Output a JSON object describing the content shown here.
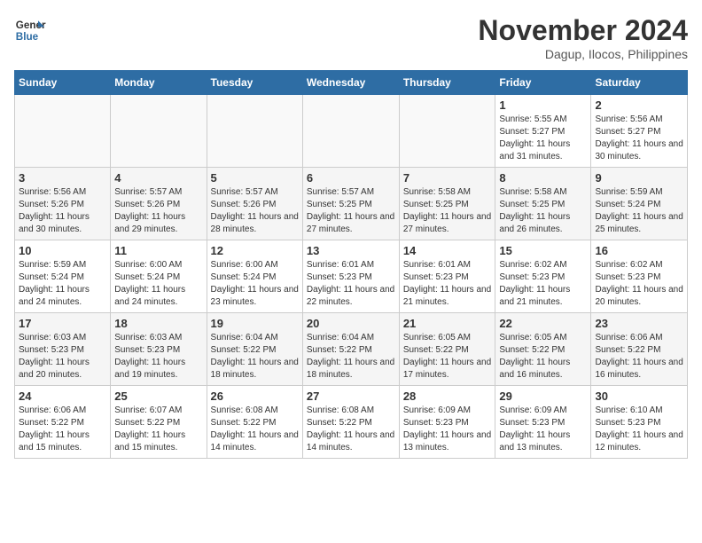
{
  "header": {
    "logo_line1": "General",
    "logo_line2": "Blue",
    "month_title": "November 2024",
    "location": "Dagup, Ilocos, Philippines"
  },
  "weekdays": [
    "Sunday",
    "Monday",
    "Tuesday",
    "Wednesday",
    "Thursday",
    "Friday",
    "Saturday"
  ],
  "weeks": [
    [
      {
        "day": "",
        "info": ""
      },
      {
        "day": "",
        "info": ""
      },
      {
        "day": "",
        "info": ""
      },
      {
        "day": "",
        "info": ""
      },
      {
        "day": "",
        "info": ""
      },
      {
        "day": "1",
        "info": "Sunrise: 5:55 AM\nSunset: 5:27 PM\nDaylight: 11 hours and 31 minutes."
      },
      {
        "day": "2",
        "info": "Sunrise: 5:56 AM\nSunset: 5:27 PM\nDaylight: 11 hours and 30 minutes."
      }
    ],
    [
      {
        "day": "3",
        "info": "Sunrise: 5:56 AM\nSunset: 5:26 PM\nDaylight: 11 hours and 30 minutes."
      },
      {
        "day": "4",
        "info": "Sunrise: 5:57 AM\nSunset: 5:26 PM\nDaylight: 11 hours and 29 minutes."
      },
      {
        "day": "5",
        "info": "Sunrise: 5:57 AM\nSunset: 5:26 PM\nDaylight: 11 hours and 28 minutes."
      },
      {
        "day": "6",
        "info": "Sunrise: 5:57 AM\nSunset: 5:25 PM\nDaylight: 11 hours and 27 minutes."
      },
      {
        "day": "7",
        "info": "Sunrise: 5:58 AM\nSunset: 5:25 PM\nDaylight: 11 hours and 27 minutes."
      },
      {
        "day": "8",
        "info": "Sunrise: 5:58 AM\nSunset: 5:25 PM\nDaylight: 11 hours and 26 minutes."
      },
      {
        "day": "9",
        "info": "Sunrise: 5:59 AM\nSunset: 5:24 PM\nDaylight: 11 hours and 25 minutes."
      }
    ],
    [
      {
        "day": "10",
        "info": "Sunrise: 5:59 AM\nSunset: 5:24 PM\nDaylight: 11 hours and 24 minutes."
      },
      {
        "day": "11",
        "info": "Sunrise: 6:00 AM\nSunset: 5:24 PM\nDaylight: 11 hours and 24 minutes."
      },
      {
        "day": "12",
        "info": "Sunrise: 6:00 AM\nSunset: 5:24 PM\nDaylight: 11 hours and 23 minutes."
      },
      {
        "day": "13",
        "info": "Sunrise: 6:01 AM\nSunset: 5:23 PM\nDaylight: 11 hours and 22 minutes."
      },
      {
        "day": "14",
        "info": "Sunrise: 6:01 AM\nSunset: 5:23 PM\nDaylight: 11 hours and 21 minutes."
      },
      {
        "day": "15",
        "info": "Sunrise: 6:02 AM\nSunset: 5:23 PM\nDaylight: 11 hours and 21 minutes."
      },
      {
        "day": "16",
        "info": "Sunrise: 6:02 AM\nSunset: 5:23 PM\nDaylight: 11 hours and 20 minutes."
      }
    ],
    [
      {
        "day": "17",
        "info": "Sunrise: 6:03 AM\nSunset: 5:23 PM\nDaylight: 11 hours and 20 minutes."
      },
      {
        "day": "18",
        "info": "Sunrise: 6:03 AM\nSunset: 5:23 PM\nDaylight: 11 hours and 19 minutes."
      },
      {
        "day": "19",
        "info": "Sunrise: 6:04 AM\nSunset: 5:22 PM\nDaylight: 11 hours and 18 minutes."
      },
      {
        "day": "20",
        "info": "Sunrise: 6:04 AM\nSunset: 5:22 PM\nDaylight: 11 hours and 18 minutes."
      },
      {
        "day": "21",
        "info": "Sunrise: 6:05 AM\nSunset: 5:22 PM\nDaylight: 11 hours and 17 minutes."
      },
      {
        "day": "22",
        "info": "Sunrise: 6:05 AM\nSunset: 5:22 PM\nDaylight: 11 hours and 16 minutes."
      },
      {
        "day": "23",
        "info": "Sunrise: 6:06 AM\nSunset: 5:22 PM\nDaylight: 11 hours and 16 minutes."
      }
    ],
    [
      {
        "day": "24",
        "info": "Sunrise: 6:06 AM\nSunset: 5:22 PM\nDaylight: 11 hours and 15 minutes."
      },
      {
        "day": "25",
        "info": "Sunrise: 6:07 AM\nSunset: 5:22 PM\nDaylight: 11 hours and 15 minutes."
      },
      {
        "day": "26",
        "info": "Sunrise: 6:08 AM\nSunset: 5:22 PM\nDaylight: 11 hours and 14 minutes."
      },
      {
        "day": "27",
        "info": "Sunrise: 6:08 AM\nSunset: 5:22 PM\nDaylight: 11 hours and 14 minutes."
      },
      {
        "day": "28",
        "info": "Sunrise: 6:09 AM\nSunset: 5:23 PM\nDaylight: 11 hours and 13 minutes."
      },
      {
        "day": "29",
        "info": "Sunrise: 6:09 AM\nSunset: 5:23 PM\nDaylight: 11 hours and 13 minutes."
      },
      {
        "day": "30",
        "info": "Sunrise: 6:10 AM\nSunset: 5:23 PM\nDaylight: 11 hours and 12 minutes."
      }
    ]
  ]
}
